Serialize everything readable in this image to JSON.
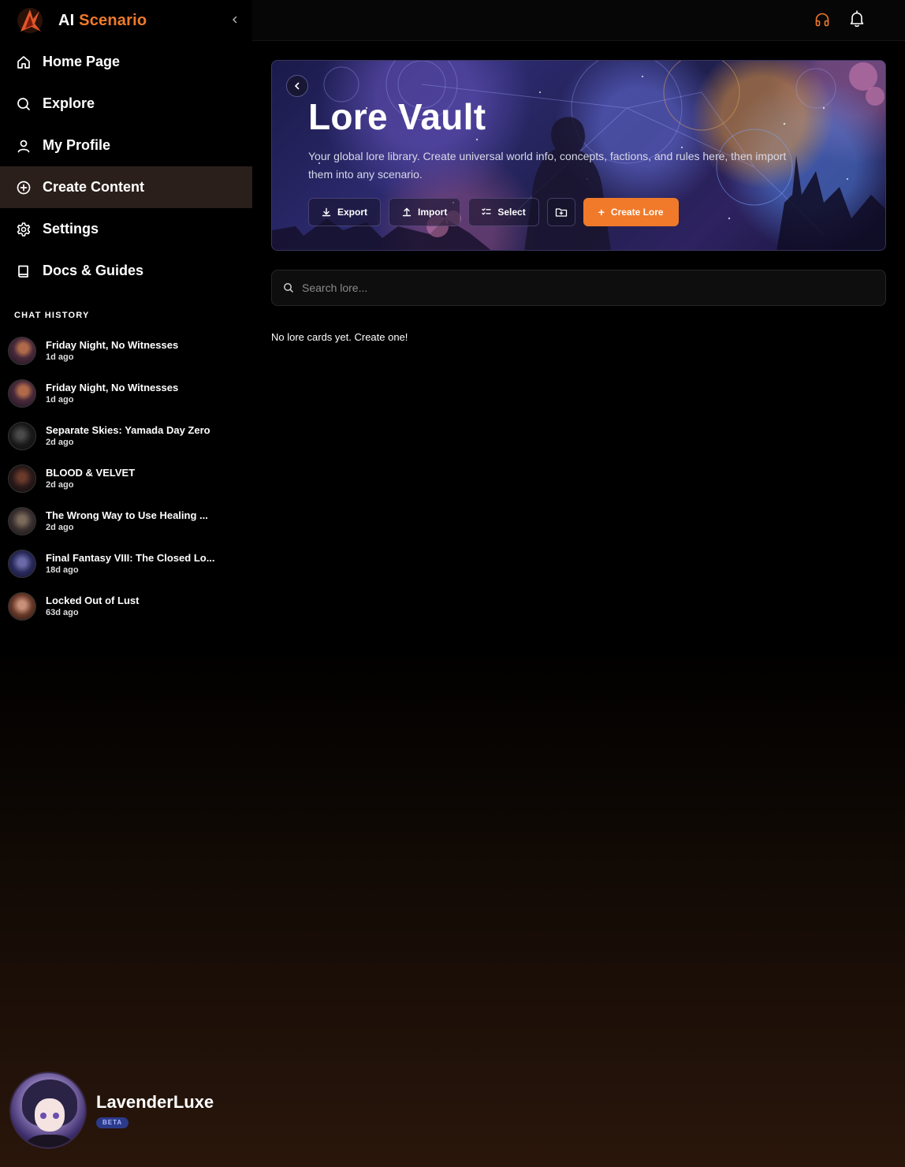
{
  "brand": {
    "name_part1": "AI",
    "name_part2": "Scenario"
  },
  "nav": {
    "items": [
      {
        "label": "Home Page",
        "icon": "home-icon"
      },
      {
        "label": "Explore",
        "icon": "search-icon"
      },
      {
        "label": "My Profile",
        "icon": "user-icon"
      },
      {
        "label": "Create Content",
        "icon": "plus-circle-icon",
        "active": true
      },
      {
        "label": "Settings",
        "icon": "gear-icon"
      },
      {
        "label": "Docs & Guides",
        "icon": "book-icon"
      }
    ]
  },
  "chat_history": {
    "title": "CHAT HISTORY",
    "items": [
      {
        "title": "Friday Night, No Witnesses",
        "time": "1d ago"
      },
      {
        "title": "Friday Night, No Witnesses",
        "time": "1d ago"
      },
      {
        "title": "Separate Skies: Yamada Day Zero",
        "time": "2d ago"
      },
      {
        "title": "BLOOD & VELVET",
        "time": "2d ago"
      },
      {
        "title": "The Wrong Way to Use Healing ...",
        "time": "2d ago"
      },
      {
        "title": "Final Fantasy VIII: The Closed Lo...",
        "time": "18d ago"
      },
      {
        "title": "Locked Out of Lust",
        "time": "63d ago"
      }
    ]
  },
  "user": {
    "name": "LavenderLuxe",
    "badge": "BETA"
  },
  "hero": {
    "title": "Lore Vault",
    "description": "Your global lore library. Create universal world info, concepts, factions, and rules here, then import them into any scenario.",
    "buttons": {
      "export": "Export",
      "import": "Import",
      "select": "Select",
      "create": "Create Lore"
    }
  },
  "search": {
    "placeholder": "Search lore..."
  },
  "empty_message": "No lore cards yet. Create one!",
  "colors": {
    "accent": "#f07a2a",
    "active_nav": "#2a1f1a",
    "beta_badge": "#2c3a8a"
  }
}
